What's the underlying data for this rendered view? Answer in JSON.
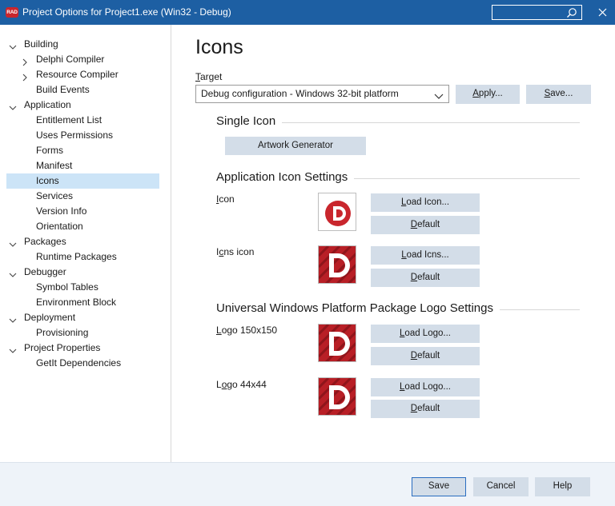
{
  "window": {
    "logo_text": "RAD",
    "title": "Project Options for Project1.exe  (Win32 - Debug)",
    "search_placeholder": "",
    "accent": "#1d5fa3"
  },
  "tree": [
    {
      "label": "Building",
      "level": 0,
      "arrow": "down"
    },
    {
      "label": "Delphi Compiler",
      "level": 1,
      "arrow": "right"
    },
    {
      "label": "Resource Compiler",
      "level": 1,
      "arrow": "right"
    },
    {
      "label": "Build Events",
      "level": 1,
      "arrow": "none"
    },
    {
      "label": "Application",
      "level": 0,
      "arrow": "down"
    },
    {
      "label": "Entitlement List",
      "level": 1,
      "arrow": "none"
    },
    {
      "label": "Uses Permissions",
      "level": 1,
      "arrow": "none"
    },
    {
      "label": "Forms",
      "level": 1,
      "arrow": "none"
    },
    {
      "label": "Manifest",
      "level": 1,
      "arrow": "none"
    },
    {
      "label": "Icons",
      "level": 1,
      "arrow": "none",
      "selected": true
    },
    {
      "label": "Services",
      "level": 1,
      "arrow": "none"
    },
    {
      "label": "Version Info",
      "level": 1,
      "arrow": "none"
    },
    {
      "label": "Orientation",
      "level": 1,
      "arrow": "none"
    },
    {
      "label": "Packages",
      "level": 0,
      "arrow": "down"
    },
    {
      "label": "Runtime Packages",
      "level": 1,
      "arrow": "none"
    },
    {
      "label": "Debugger",
      "level": 0,
      "arrow": "down"
    },
    {
      "label": "Symbol Tables",
      "level": 1,
      "arrow": "none"
    },
    {
      "label": "Environment Block",
      "level": 1,
      "arrow": "none"
    },
    {
      "label": "Deployment",
      "level": 0,
      "arrow": "down"
    },
    {
      "label": "Provisioning",
      "level": 1,
      "arrow": "none"
    },
    {
      "label": "Project Properties",
      "level": 0,
      "arrow": "down"
    },
    {
      "label": "GetIt Dependencies",
      "level": 1,
      "arrow": "none"
    }
  ],
  "main": {
    "title": "Icons",
    "target": {
      "label_first": "T",
      "label_rest": "arget",
      "value": "Debug configuration - Windows 32-bit platform"
    },
    "apply": {
      "first": "A",
      "rest": "pply..."
    },
    "save_top": {
      "first": "S",
      "rest": "ave..."
    },
    "single_icon": {
      "title": "Single Icon",
      "artwork_button": "Artwork Generator"
    },
    "app_icon": {
      "title": "Application Icon Settings",
      "icon_label": {
        "first": "I",
        "rest": "con"
      },
      "load_icon": {
        "first": "L",
        "rest": "oad Icon..."
      },
      "default1": {
        "first": "D",
        "rest": "efault"
      },
      "icns_label": {
        "first": "I",
        "u": "c",
        "rest": "ns icon"
      },
      "load_icns": {
        "first": "L",
        "rest": "oad Icns..."
      },
      "default2": {
        "first": "D",
        "rest": "efault"
      }
    },
    "uwp": {
      "title": "Universal Windows Platform Package Logo Settings",
      "logo150_label": {
        "first": "L",
        "rest": "ogo 150x150"
      },
      "load_logo1": {
        "first": "L",
        "rest": "oad Logo..."
      },
      "default3": {
        "first": "D",
        "rest": "efault"
      },
      "logo44_label": {
        "first": "L",
        "u": "o",
        "rest": "go 44x44"
      },
      "load_logo2": {
        "first": "L",
        "rest": "oad Logo..."
      },
      "default4": {
        "first": "D",
        "rest": "efault"
      }
    }
  },
  "footer": {
    "save": "Save",
    "cancel": "Cancel",
    "help": "Help"
  },
  "colors": {
    "selection": "#cce4f7",
    "button": "#d3dde8",
    "footer": "#eef3f9",
    "logo_red": "#c9262d"
  }
}
